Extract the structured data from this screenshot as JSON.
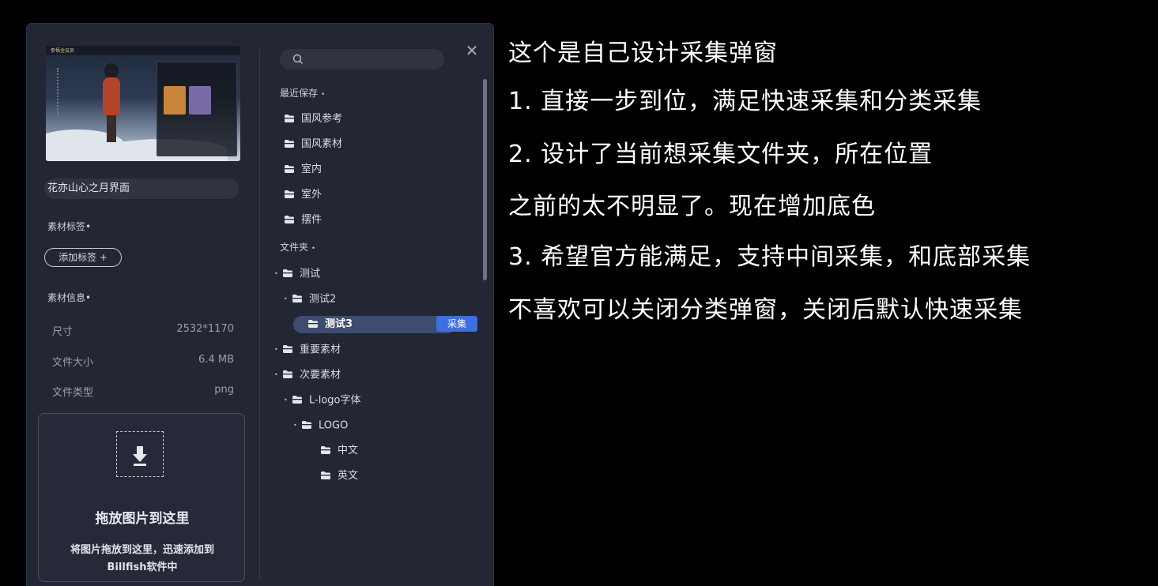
{
  "dialog": {
    "preview": {
      "image_title": "参悟全议员"
    },
    "name_field_value": "花亦山心之月界面",
    "tags_label": "素材标签",
    "add_tag_label": "添加标签 +",
    "info_label": "素材信息",
    "info_rows": [
      {
        "key": "尺寸",
        "value": "2532*1170"
      },
      {
        "key": "文件大小",
        "value": "6.4 MB"
      },
      {
        "key": "文件类型",
        "value": "png"
      }
    ],
    "dropzone": {
      "title": "拖放图片到这里",
      "desc_line1": "将图片拖放到这里，迅速添加到",
      "desc_line2": "Billfish软件中"
    },
    "search": {
      "placeholder": ""
    },
    "close_icon": "close-icon",
    "recent_label": "最近保存",
    "recent_items": [
      "国风参考",
      "国风素材",
      "室内",
      "室外",
      "摆件"
    ],
    "folders_label": "文件夹",
    "folders": [
      {
        "label": "测试",
        "level": 0,
        "expandable": true
      },
      {
        "label": "测试2",
        "level": 1,
        "expandable": true
      },
      {
        "label": "测试3",
        "level": 2,
        "expandable": false,
        "selected": true
      },
      {
        "label": "重要素材",
        "level": 0,
        "expandable": true
      },
      {
        "label": "次要素材",
        "level": 0,
        "expandable": true
      },
      {
        "label": "L-logo字体",
        "level": 1,
        "expandable": true
      },
      {
        "label": "LOGO",
        "level": 2,
        "expandable": true
      },
      {
        "label": "中文",
        "level": 3,
        "expandable": false
      },
      {
        "label": "英文",
        "level": 3,
        "expandable": false
      }
    ],
    "collect_badge": "采集",
    "colors": {
      "accent": "#3d6fe0",
      "panel": "#232633",
      "selected_row": "#3e4c6f"
    }
  },
  "notes": [
    "这个是自己设计采集弹窗",
    "1. 直接一步到位，满足快速采集和分类采集",
    "2. 设计了当前想采集文件夹，所在位置",
    "之前的太不明显了。现在增加底色",
    "3. 希望官方能满足，支持中间采集，和底部采集",
    "不喜欢可以关闭分类弹窗，关闭后默认快速采集"
  ]
}
